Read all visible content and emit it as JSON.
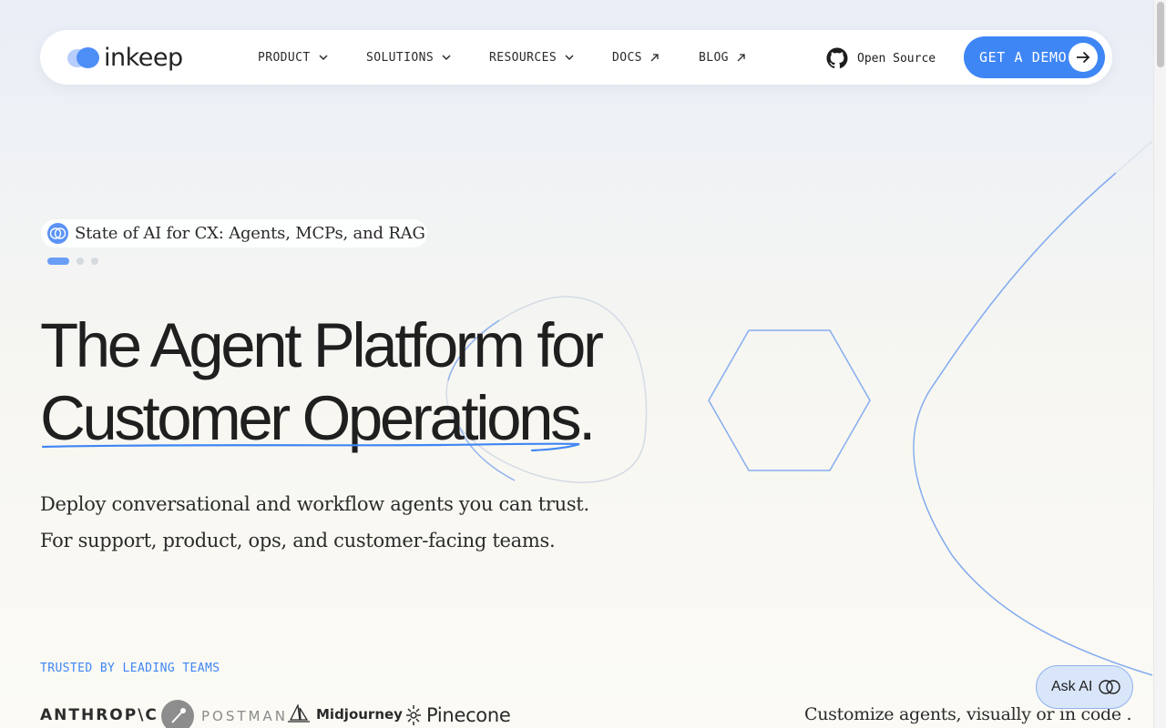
{
  "brand": {
    "name": "inkeep"
  },
  "nav": {
    "items": [
      {
        "label": "PRODUCT",
        "kind": "dropdown"
      },
      {
        "label": "SOLUTIONS",
        "kind": "dropdown"
      },
      {
        "label": "RESOURCES",
        "kind": "dropdown"
      },
      {
        "label": "DOCS",
        "kind": "external"
      },
      {
        "label": "BLOG",
        "kind": "external"
      }
    ],
    "github_label": "Open Source",
    "cta_label": "GET A DEMO"
  },
  "announcement": {
    "text": "State of AI for CX: Agents, MCPs, and RAG",
    "carousel_total": 3,
    "carousel_active": 1
  },
  "hero": {
    "headline_line1": "The Agent Platform for",
    "headline_line2": "Customer Operations.",
    "sub_line1": "Deploy conversational and workflow agents you can trust.",
    "sub_line2": "For support, product, ops, and customer-facing teams."
  },
  "trusted": {
    "label": "TRUSTED BY LEADING TEAMS",
    "logos": [
      "ANTHROP\\C",
      "POSTMAN",
      "Midjourney",
      "Pinecone"
    ]
  },
  "next_section_teaser": "Customize agents, visually or in code .",
  "ask_ai": {
    "label": "Ask AI"
  },
  "colors": {
    "accent": "#3f86f5",
    "accent_light": "#6a9ef6",
    "text": "#1f1f1f"
  }
}
